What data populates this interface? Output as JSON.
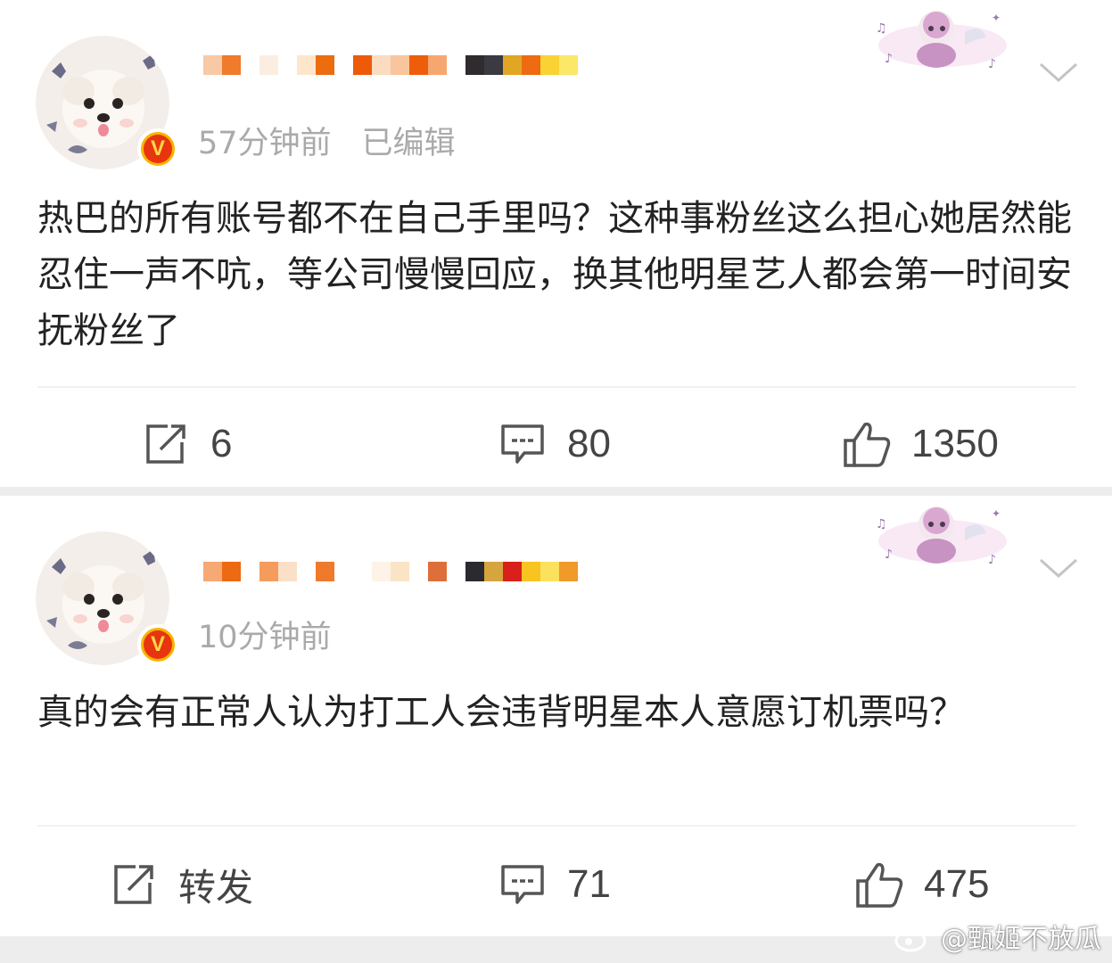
{
  "posts": [
    {
      "timestamp": "57分钟前",
      "edited": "已编辑",
      "verified_badge": "V",
      "content": "热巴的所有账号都不在自己手里吗？这种事粉丝这么担心她居然能忍住一声不吭，等公司慢慢回应，换其他明星艺人都会第一时间安抚粉丝了",
      "repost": "6",
      "comments": "80",
      "likes": "1350"
    },
    {
      "timestamp": "10分钟前",
      "verified_badge": "V",
      "content": "真的会有正常人认为打工人会违背明星本人意愿订机票吗？",
      "repost": "转发",
      "comments": "71",
      "likes": "475"
    }
  ],
  "watermark": "@甄姬不放瓜",
  "colors": {
    "background": "#ededed",
    "card": "#ffffff",
    "meta_text": "#aaaaaa",
    "badge_gold": "#f7b500",
    "badge_red": "#e8340f"
  },
  "icons": [
    "avatar-dog",
    "verified-badge",
    "sticker-decoration",
    "chevron-down-icon",
    "repost-icon",
    "comment-icon",
    "like-icon",
    "weibo-logo-icon"
  ]
}
